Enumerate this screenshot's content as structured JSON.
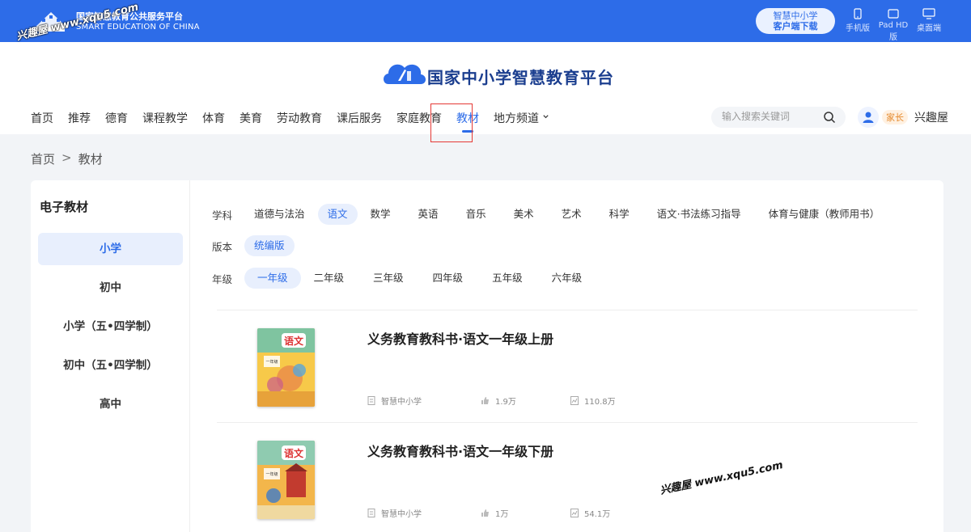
{
  "topbar": {
    "brand_cn": "国家智慧教育公共服务平台",
    "brand_en": "SMART EDUCATION OF CHINA",
    "watermark": "兴趣屋 www.xqu5.com",
    "download_line1": "智慧中小学",
    "download_line2": "客户端下载",
    "devices": [
      {
        "label": "手机版",
        "icon": "phone-icon"
      },
      {
        "label": "Pad HD版",
        "icon": "tablet-icon"
      },
      {
        "label": "桌面端",
        "icon": "desktop-icon"
      }
    ],
    "bg_color": "#2d6ce8"
  },
  "header": {
    "site_title": "国家中小学智慧教育平台",
    "nav": [
      "首页",
      "推荐",
      "德育",
      "课程教学",
      "体育",
      "美育",
      "劳动教育",
      "课后服务",
      "家庭教育",
      "教材",
      "地方频道"
    ],
    "active_nav": "教材",
    "search_placeholder": "输入搜索关键词",
    "user_role": "家长",
    "user_name": "兴趣屋"
  },
  "breadcrumb": {
    "home": "首页",
    "sep": ">",
    "current": "教材"
  },
  "sidebar": {
    "title": "电子教材",
    "items": [
      "小学",
      "初中",
      "小学（五•四学制）",
      "初中（五•四学制）",
      "高中"
    ],
    "active": "小学"
  },
  "filters": {
    "subject_label": "学科",
    "subjects": [
      "道德与法治",
      "语文",
      "数学",
      "英语",
      "音乐",
      "美术",
      "艺术",
      "科学",
      "语文·书法练习指导",
      "体育与健康（教师用书）"
    ],
    "subject_active": "语文",
    "edition_label": "版本",
    "editions": [
      "统编版"
    ],
    "edition_active": "统编版",
    "grade_label": "年级",
    "grades": [
      "一年级",
      "二年级",
      "三年级",
      "四年级",
      "五年级",
      "六年级"
    ],
    "grade_active": "一年级"
  },
  "books": [
    {
      "title": "义务教育教科书·语文一年级上册",
      "source": "智慧中小学",
      "likes": "1.9万",
      "views": "110.8万",
      "cover_text": "语文",
      "cover_grade": "一年级",
      "cover_vol": "上册"
    },
    {
      "title": "义务教育教科书·语文一年级下册",
      "source": "智慧中小学",
      "likes": "1万",
      "views": "54.1万",
      "cover_text": "语文",
      "cover_grade": "一年级",
      "cover_vol": "下册"
    }
  ],
  "watermark2": "兴趣屋 www.xqu5.com"
}
